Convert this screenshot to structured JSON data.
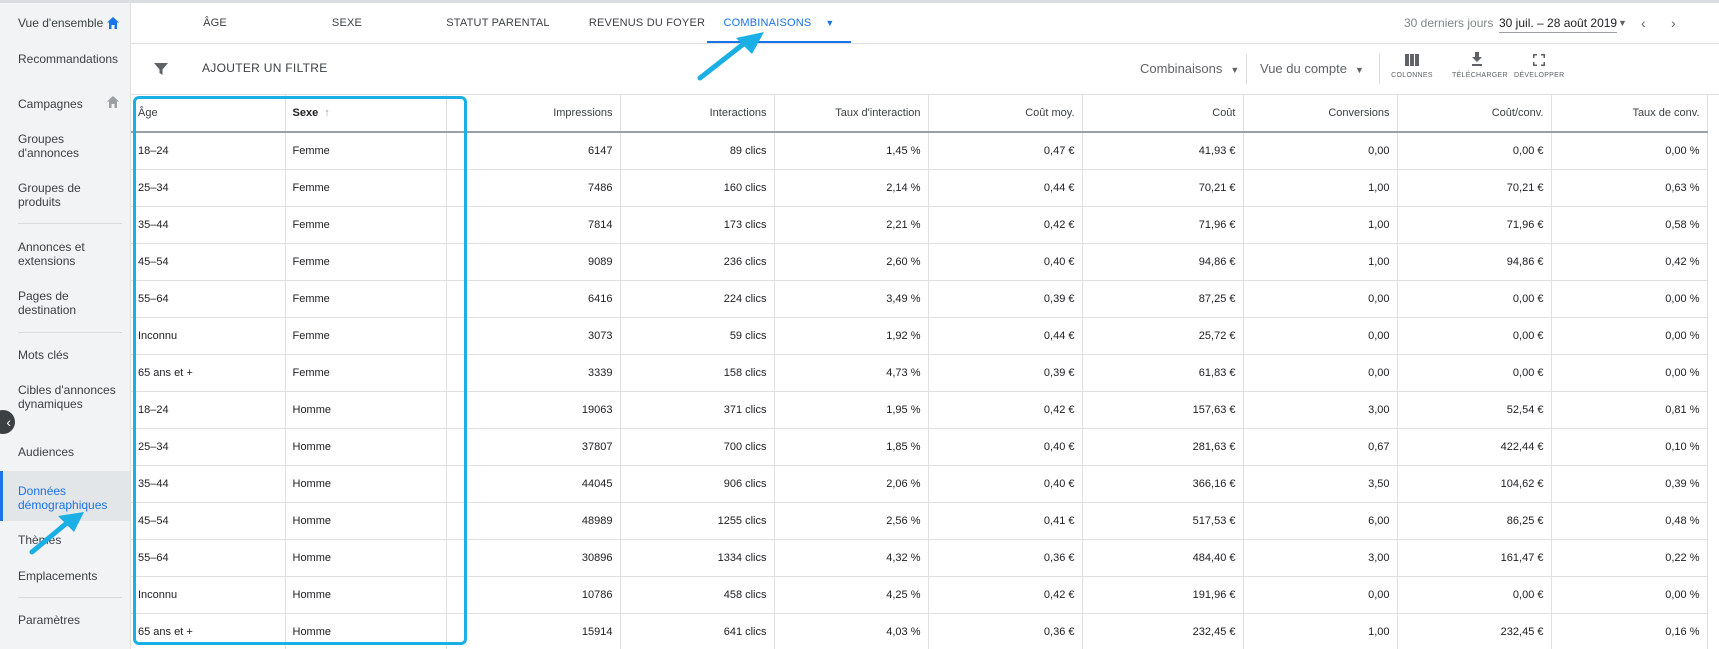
{
  "sidebar": {
    "items": [
      {
        "label": "Vue d'ensemble"
      },
      {
        "label": "Recommandations"
      },
      {
        "label": "Campagnes"
      },
      {
        "label": "Groupes d'annonces"
      },
      {
        "label": "Groupes de produits"
      },
      {
        "label": "Annonces et extensions"
      },
      {
        "label": "Pages de destination"
      },
      {
        "label": "Mots clés"
      },
      {
        "label": "Cibles d'annonces dynamiques"
      },
      {
        "label": "Audiences"
      },
      {
        "label": "Données démographiques"
      },
      {
        "label": "Thèmes"
      },
      {
        "label": "Emplacements"
      },
      {
        "label": "Paramètres"
      }
    ],
    "collapse_glyph": "‹"
  },
  "tabs": [
    {
      "label": "ÂGE"
    },
    {
      "label": "SEXE"
    },
    {
      "label": "STATUT PARENTAL"
    },
    {
      "label": "REVENUS DU FOYER"
    },
    {
      "label": "COMBINAISONS"
    }
  ],
  "date": {
    "preset": "30 derniers jours",
    "range": "30 juil. – 28 août 2019"
  },
  "toolbar": {
    "add_filter": "AJOUTER UN FILTRE",
    "dropdown_1": "Combinaisons",
    "dropdown_2": "Vue du compte",
    "tools": [
      {
        "icon": "columns-icon",
        "label": "COLONNES"
      },
      {
        "icon": "download-icon",
        "label": "TÉLÉCHARGER"
      },
      {
        "icon": "fullscreen-icon",
        "label": "DÉVELOPPER"
      }
    ]
  },
  "table": {
    "headers": [
      "Âge",
      "Sexe",
      "Impressions",
      "Interactions",
      "Taux d'interaction",
      "Coût moy.",
      "Coût",
      "Conversions",
      "Coût/conv.",
      "Taux de conv."
    ],
    "rows": [
      [
        "18–24",
        "Femme",
        "6147",
        "89 clics",
        "1,45 %",
        "0,47 €",
        "41,93 €",
        "0,00",
        "0,00 €",
        "0,00 %"
      ],
      [
        "25–34",
        "Femme",
        "7486",
        "160 clics",
        "2,14 %",
        "0,44 €",
        "70,21 €",
        "1,00",
        "70,21 €",
        "0,63 %"
      ],
      [
        "35–44",
        "Femme",
        "7814",
        "173 clics",
        "2,21 %",
        "0,42 €",
        "71,96 €",
        "1,00",
        "71,96 €",
        "0,58 %"
      ],
      [
        "45–54",
        "Femme",
        "9089",
        "236 clics",
        "2,60 %",
        "0,40 €",
        "94,86 €",
        "1,00",
        "94,86 €",
        "0,42 %"
      ],
      [
        "55–64",
        "Femme",
        "6416",
        "224 clics",
        "3,49 %",
        "0,39 €",
        "87,25 €",
        "0,00",
        "0,00 €",
        "0,00 %"
      ],
      [
        "Inconnu",
        "Femme",
        "3073",
        "59 clics",
        "1,92 %",
        "0,44 €",
        "25,72 €",
        "0,00",
        "0,00 €",
        "0,00 %"
      ],
      [
        "65 ans et +",
        "Femme",
        "3339",
        "158 clics",
        "4,73 %",
        "0,39 €",
        "61,83 €",
        "0,00",
        "0,00 €",
        "0,00 %"
      ],
      [
        "18–24",
        "Homme",
        "19063",
        "371 clics",
        "1,95 %",
        "0,42 €",
        "157,63 €",
        "3,00",
        "52,54 €",
        "0,81 %"
      ],
      [
        "25–34",
        "Homme",
        "37807",
        "700 clics",
        "1,85 %",
        "0,40 €",
        "281,63 €",
        "0,67",
        "422,44 €",
        "0,10 %"
      ],
      [
        "35–44",
        "Homme",
        "44045",
        "906 clics",
        "2,06 %",
        "0,40 €",
        "366,16 €",
        "3,50",
        "104,62 €",
        "0,39 %"
      ],
      [
        "45–54",
        "Homme",
        "48989",
        "1255 clics",
        "2,56 %",
        "0,41 €",
        "517,53 €",
        "6,00",
        "86,25 €",
        "0,48 %"
      ],
      [
        "55–64",
        "Homme",
        "30896",
        "1334 clics",
        "4,32 %",
        "0,36 €",
        "484,40 €",
        "3,00",
        "161,47 €",
        "0,22 %"
      ],
      [
        "Inconnu",
        "Homme",
        "10786",
        "458 clics",
        "4,25 %",
        "0,42 €",
        "191,96 €",
        "0,00",
        "0,00 €",
        "0,00 %"
      ],
      [
        "65 ans et +",
        "Homme",
        "15914",
        "641 clics",
        "4,03 %",
        "0,36 €",
        "232,45 €",
        "1,00",
        "232,45 €",
        "0,16 %"
      ]
    ]
  },
  "colors": {
    "accent": "#1a73e8",
    "annotation": "#1ab0e6"
  }
}
